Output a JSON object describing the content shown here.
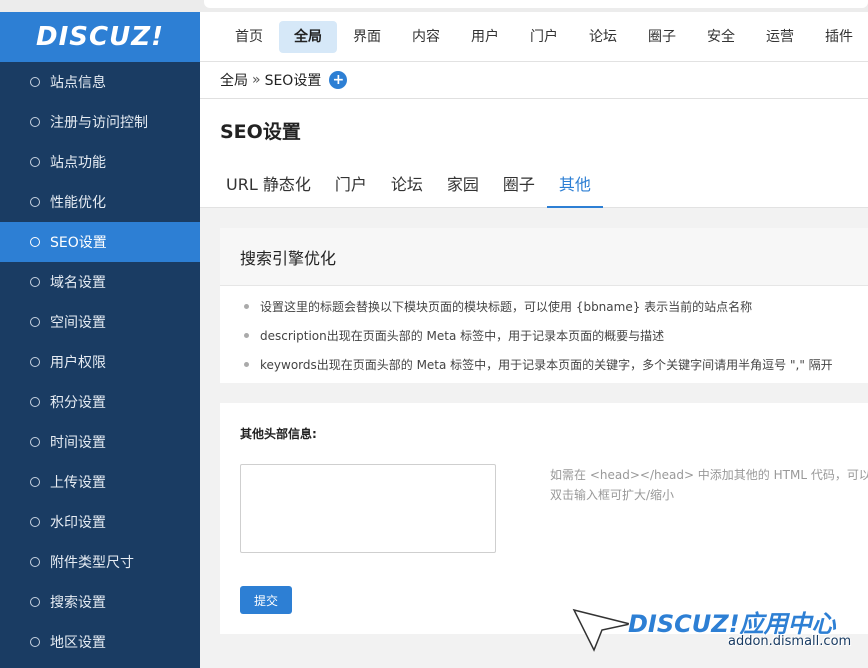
{
  "logo": {
    "text": "DISCUZ!"
  },
  "topnav": {
    "items": [
      {
        "label": "首页",
        "active": false
      },
      {
        "label": "全局",
        "active": true
      },
      {
        "label": "界面",
        "active": false
      },
      {
        "label": "内容",
        "active": false
      },
      {
        "label": "用户",
        "active": false
      },
      {
        "label": "门户",
        "active": false
      },
      {
        "label": "论坛",
        "active": false
      },
      {
        "label": "圈子",
        "active": false
      },
      {
        "label": "安全",
        "active": false
      },
      {
        "label": "运营",
        "active": false
      },
      {
        "label": "插件",
        "active": false
      }
    ]
  },
  "sidebar": {
    "items": [
      {
        "label": "站点信息"
      },
      {
        "label": "注册与访问控制"
      },
      {
        "label": "站点功能"
      },
      {
        "label": "性能优化"
      },
      {
        "label": "SEO设置"
      },
      {
        "label": "域名设置"
      },
      {
        "label": "空间设置"
      },
      {
        "label": "用户权限"
      },
      {
        "label": "积分设置"
      },
      {
        "label": "时间设置"
      },
      {
        "label": "上传设置"
      },
      {
        "label": "水印设置"
      },
      {
        "label": "附件类型尺寸"
      },
      {
        "label": "搜索设置"
      },
      {
        "label": "地区设置"
      }
    ],
    "active_index": 4
  },
  "breadcrumb": {
    "root": "全局",
    "sep": "»",
    "current": "SEO设置",
    "add_icon": "plus-circle-icon"
  },
  "page": {
    "title": "SEO设置"
  },
  "tabs": [
    {
      "label": "URL 静态化"
    },
    {
      "label": "门户"
    },
    {
      "label": "论坛"
    },
    {
      "label": "家园"
    },
    {
      "label": "圈子"
    },
    {
      "label": "其他"
    }
  ],
  "active_tab": 5,
  "tips": {
    "title": "搜索引擎优化",
    "items": [
      "设置这里的标题会替换以下模块页面的模块标题，可以使用 {bbname} 表示当前的站点名称",
      "description出现在页面头部的 Meta 标签中，用于记录本页面的概要与描述",
      "keywords出现在页面头部的 Meta 标签中，用于记录本页面的关键字，多个关键字间请用半角逗号 \",\" 隔开"
    ]
  },
  "form": {
    "label": "其他头部信息:",
    "value": "",
    "hint_line1": "如需在 <head></head> 中添加其他的 HTML 代码，可以使",
    "hint_line2": "双击输入框可扩大/缩小",
    "submit_label": "提交"
  },
  "watermark": {
    "logo": "DISCUZ!应用中心",
    "url": "addon.dismall.com"
  },
  "colors": {
    "brand": "#2d7fd4",
    "sidebar_bg": "#1a3c63",
    "nav_active_bg": "#d6e8f8"
  }
}
